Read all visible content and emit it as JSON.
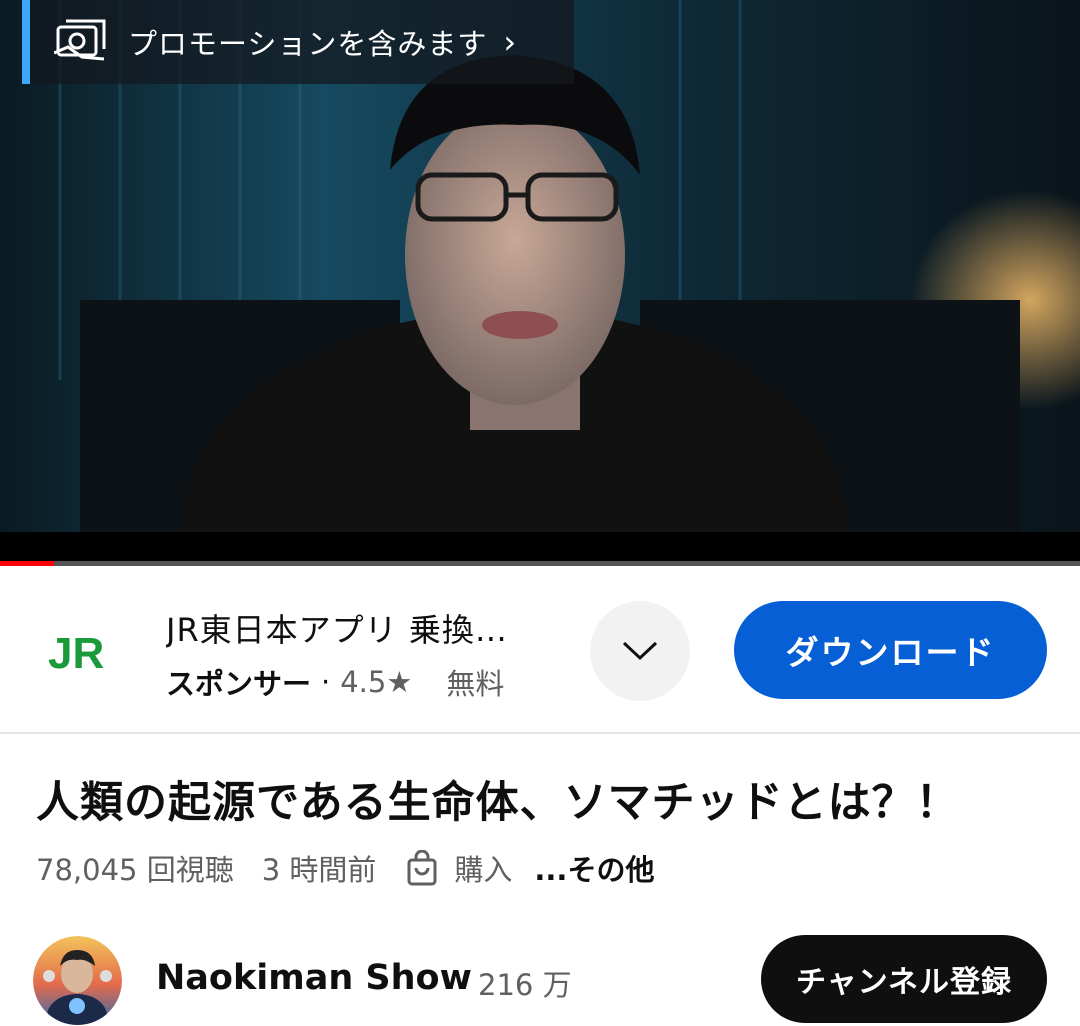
{
  "player": {
    "promo_label": "プロモーションを含みます",
    "progress_fraction": 0.05
  },
  "ad": {
    "title": "JR東日本アプリ 乗換…",
    "sponsor_label": "スポンサー",
    "separator": "·",
    "rating": "4.5★",
    "price": "無料",
    "download_label": "ダウンロード",
    "logo_text": "JR",
    "logo_color": "#1a9a3b",
    "button_color": "#065fd4"
  },
  "video": {
    "title": "人類の起源である生命体、ソマチッドとは？！",
    "views": "78,045 回視聴",
    "time_ago": "3 時間前",
    "purchase_label": "購入",
    "more_label": "...その他"
  },
  "channel": {
    "name": "Naokiman Show",
    "subscribers": "216 万",
    "subscribe_label": "チャンネル登録"
  },
  "icons": {
    "promo": "promotion-icon",
    "chevron_right": "chevron-right-icon",
    "expand": "chevron-down-icon",
    "purchase": "shopping-bag-icon"
  }
}
